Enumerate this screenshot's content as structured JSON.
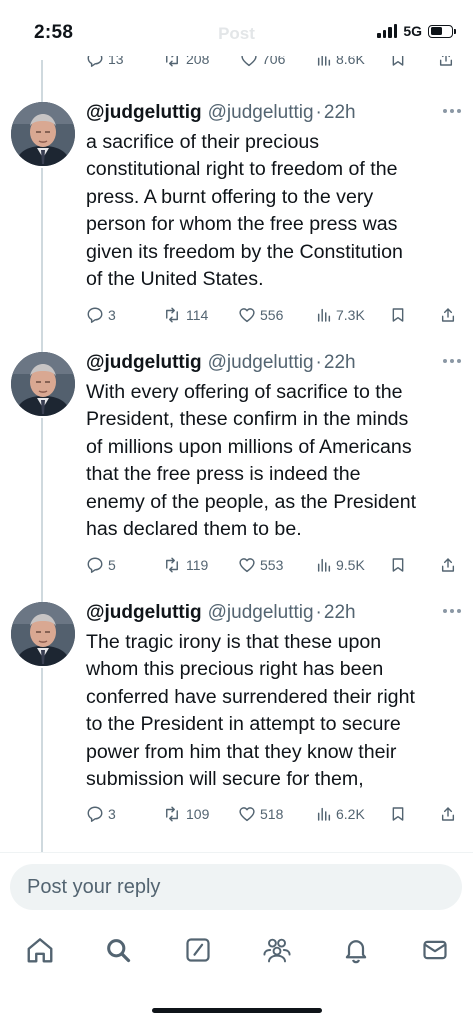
{
  "status_bar": {
    "time": "2:58",
    "network": "5G"
  },
  "header": {
    "title": "Post"
  },
  "previous_post_actions": {
    "replies": "13",
    "reposts": "208",
    "likes": "706",
    "views": "8.6K"
  },
  "posts": [
    {
      "name": "@judgeluttig",
      "handle": "@judgeluttig",
      "separator": "·",
      "time": "22h",
      "lines": [
        "a sacrifice of their precious",
        "constitutional right to freedom of the",
        "press. A burnt offering to the very",
        "person for whom the free press was",
        "given its freedom by the Constitution",
        "of the United States."
      ],
      "replies": "3",
      "reposts": "114",
      "likes": "556",
      "views": "7.3K"
    },
    {
      "name": "@judgeluttig",
      "handle": "@judgeluttig",
      "separator": "·",
      "time": "22h",
      "lines": [
        "With every offering of sacrifice to the",
        "President, these confirm in the minds",
        "of millions upon millions of Americans",
        "that the free press is indeed the",
        "enemy of the people, as the President",
        "has declared them to be."
      ],
      "replies": "5",
      "reposts": "119",
      "likes": "553",
      "views": "9.5K"
    },
    {
      "name": "@judgeluttig",
      "handle": "@judgeluttig",
      "separator": "·",
      "time": "22h",
      "lines": [
        "The tragic irony is that these upon",
        "whom this precious right has been",
        "conferred have surrendered their right",
        "to the President in attempt to secure",
        "power from him that they know their",
        "submission will secure for them,"
      ],
      "replies": "3",
      "reposts": "109",
      "likes": "518",
      "views": "6.2K"
    }
  ],
  "reply": {
    "placeholder": "Post your reply"
  },
  "nav": [
    "home-icon",
    "search-icon",
    "grok-icon",
    "communities-icon",
    "notifications-icon",
    "messages-icon"
  ]
}
